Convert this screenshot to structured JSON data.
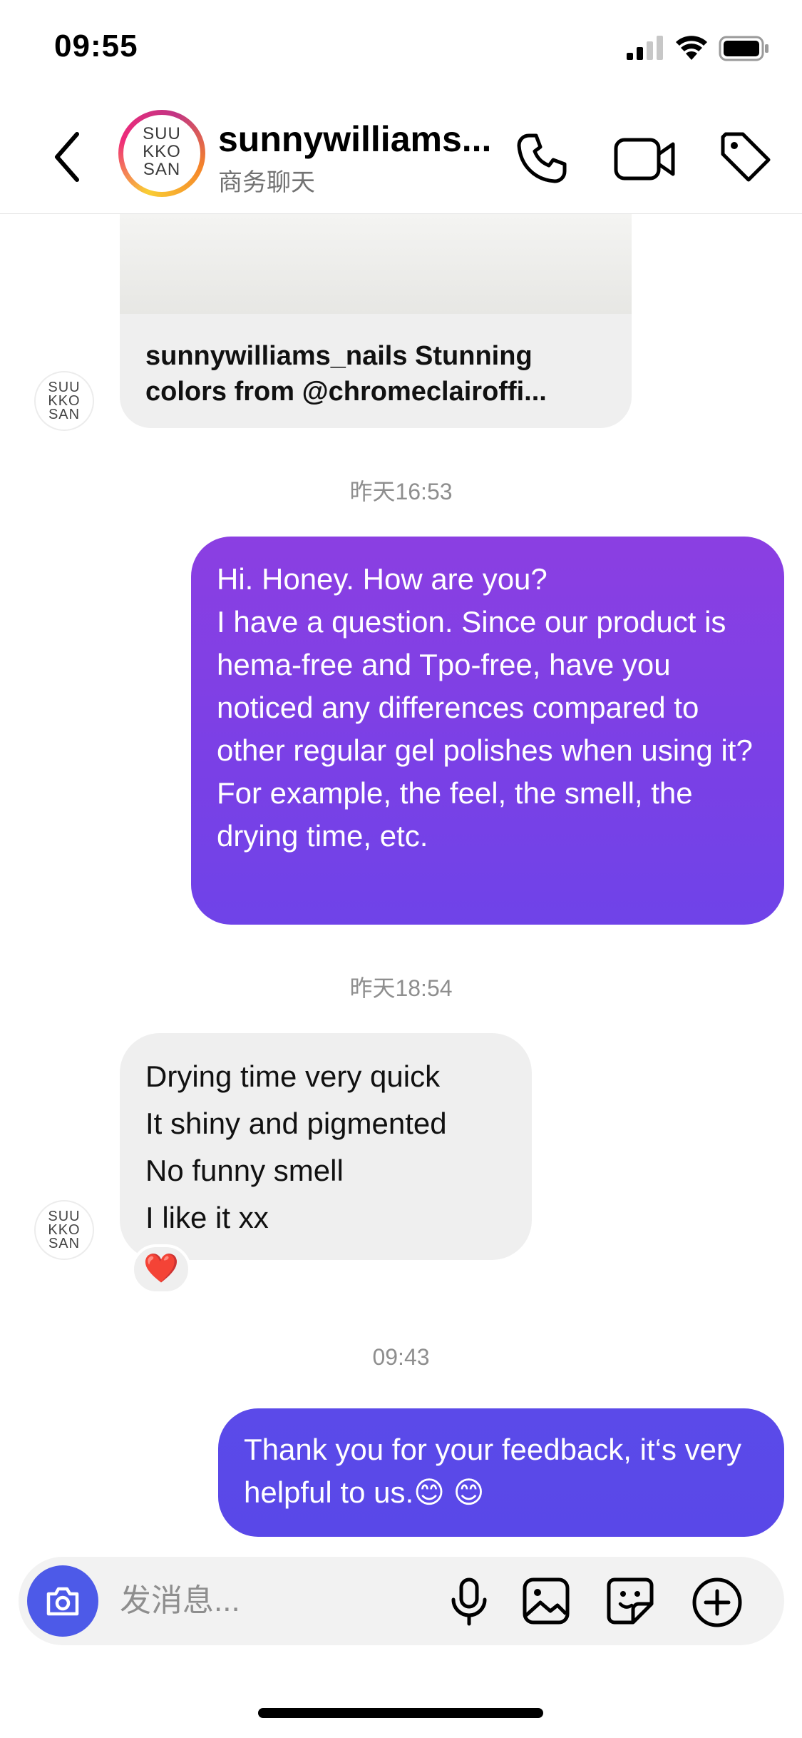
{
  "status_bar": {
    "time": "09:55"
  },
  "header": {
    "name": "sunnywilliams...",
    "subtitle": "商务聊天",
    "avatar_logo": [
      "SUU",
      "KKO",
      "SAN"
    ]
  },
  "shared_post": {
    "caption": "sunnywilliams_nails Stunning colors from @chromeclairoffi..."
  },
  "messages": [
    {
      "type": "timestamp",
      "text": "昨天16:53"
    },
    {
      "type": "outgoing",
      "text": "Hi. Honey. How are you?\nI have a question. Since our product is hema-free and Tpo-free, have you noticed any differences compared to other regular gel polishes when using it? For example, the feel, the smell, the drying time, etc."
    },
    {
      "type": "timestamp",
      "text": "昨天18:54"
    },
    {
      "type": "incoming",
      "text": "Drying time very quick\nIt shiny and pigmented\nNo funny smell\nI like it xx",
      "reaction": "❤️"
    },
    {
      "type": "timestamp",
      "text": "09:43"
    },
    {
      "type": "outgoing",
      "text": "Thank you for your feedback, it‘s very helpful to us.😊 😊"
    }
  ],
  "composer": {
    "placeholder": "发消息..."
  },
  "colors": {
    "outgoing_bubble_top": "#8b3fe2",
    "outgoing_bubble_bottom": "#6f43e8",
    "outgoing_bubble_latest": "#5b4ae9",
    "incoming_bubble": "#efefef",
    "camera_button": "#4d5ae8",
    "timestamp_text": "#8e8e8e"
  },
  "icons": [
    "signal-icon",
    "wifi-icon",
    "battery-icon",
    "back-icon",
    "phone-icon",
    "video-icon",
    "tag-icon",
    "camera-icon",
    "microphone-icon",
    "image-icon",
    "sticker-icon",
    "plus-icon"
  ]
}
